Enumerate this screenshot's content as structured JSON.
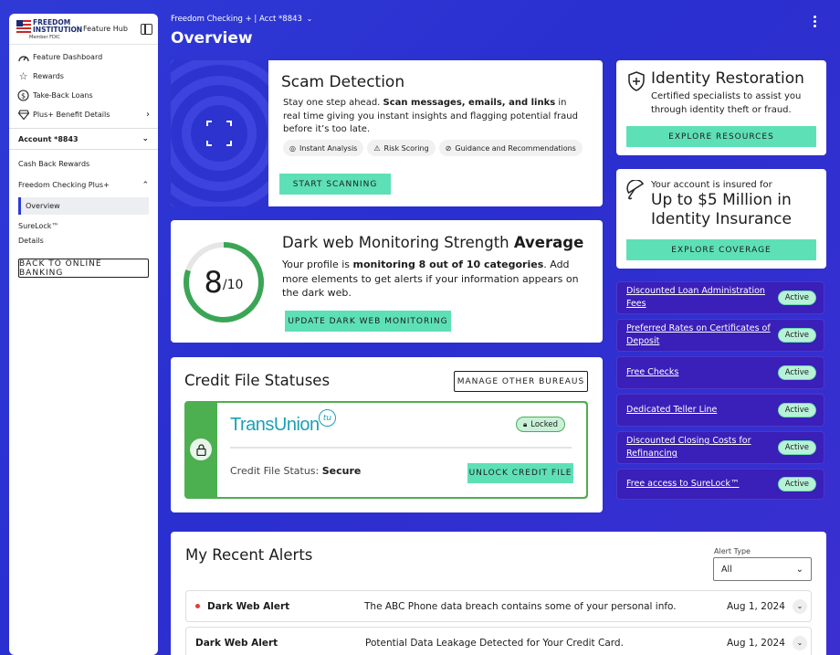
{
  "sidebar": {
    "logo_line1": "FREEDOM",
    "logo_line2": "INSTITUTION",
    "logo_member": "Member FDIC",
    "hub_label": "Feature Hub",
    "items": [
      {
        "label": "Feature Dashboard",
        "icon": "dashboard-gauge-icon"
      },
      {
        "label": "Rewards",
        "icon": "star-icon"
      },
      {
        "label": "Take-Back Loans",
        "icon": "dollar-cycle-icon"
      },
      {
        "label": "Plus+ Benefit Details",
        "icon": "diamond-icon"
      }
    ],
    "account_label": "Account *8843",
    "cash_back": "Cash Back Rewards",
    "freedom_checking": "Freedom Checking Plus+",
    "overview": "Overview",
    "surelock": "SureLock™",
    "details": "Details",
    "back_button": "BACK TO ONLINE BANKING"
  },
  "header": {
    "breadcrumb": "Freedom Checking + | Acct *8843",
    "title": "Overview"
  },
  "scam": {
    "title": "Scam Detection",
    "body_1": "Stay one step ahead. ",
    "body_bold": "Scan messages, emails, and links",
    "body_2": " in real time giving you instant insights and flagging potential fraud before it’s too late.",
    "chips": [
      "Instant Analysis",
      "Risk Scoring",
      "Guidance and Recommendations"
    ],
    "button": "START SCANNING"
  },
  "darkweb": {
    "score": "8",
    "score_max": "/10",
    "score_fraction": 0.8,
    "title": "Dark web Monitoring Strength ",
    "title_bold": "Average",
    "body_1": "Your profile is ",
    "body_bold": "monitoring 8 out of 10 categories",
    "body_2": ". Add more elements to get alerts if your information appears on the dark web.",
    "button": "UPDATE DARK WEB MONITORING"
  },
  "credit": {
    "title": "Credit File Statuses",
    "manage_button": "MANAGE OTHER BUREAUS",
    "bureau": "TransUnion",
    "locked_badge": "Locked",
    "status_label": "Credit File Status: ",
    "status_value": "Secure",
    "unlock_button": "UNLOCK CREDIT FILE"
  },
  "identity": {
    "title": "Identity Restoration",
    "body": "Certified specialists to assist you through identity theft or fraud.",
    "button": "EXPLORE RESOURCES"
  },
  "insurance": {
    "line1": "Your account is insured for",
    "big": "Up to $5 Million in Identity Insurance",
    "button": "EXPLORE COVERAGE"
  },
  "benefits": [
    {
      "label": "Discounted Loan Administration Fees",
      "status": "Active"
    },
    {
      "label": "Preferred Rates on Certificates of Deposit",
      "status": "Active"
    },
    {
      "label": "Free Checks",
      "status": "Active"
    },
    {
      "label": "Dedicated Teller Line",
      "status": "Active"
    },
    {
      "label": "Discounted Closing Costs for Refinancing",
      "status": "Active"
    },
    {
      "label": "Free access to SureLock™",
      "status": "Active"
    }
  ],
  "alerts": {
    "title": "My Recent Alerts",
    "filter_label": "Alert Type",
    "filter_value": "All",
    "rows": [
      {
        "type": "Dark Web Alert",
        "desc": "The ABC Phone data breach contains some of your personal info.",
        "date": "Aug 1, 2024",
        "unread": true
      },
      {
        "type": "Dark Web Alert",
        "desc": "Potential Data Leakage Detected for Your Credit Card.",
        "date": "Aug 1, 2024",
        "unread": false
      }
    ]
  },
  "colors": {
    "background": "#2f3ad6",
    "accent_teal": "#5ee0b6",
    "ring_green": "#3aa655",
    "locked_green": "#4caf50",
    "pill_purple": "#3a1fb8",
    "unread_dot": "#e53935"
  }
}
